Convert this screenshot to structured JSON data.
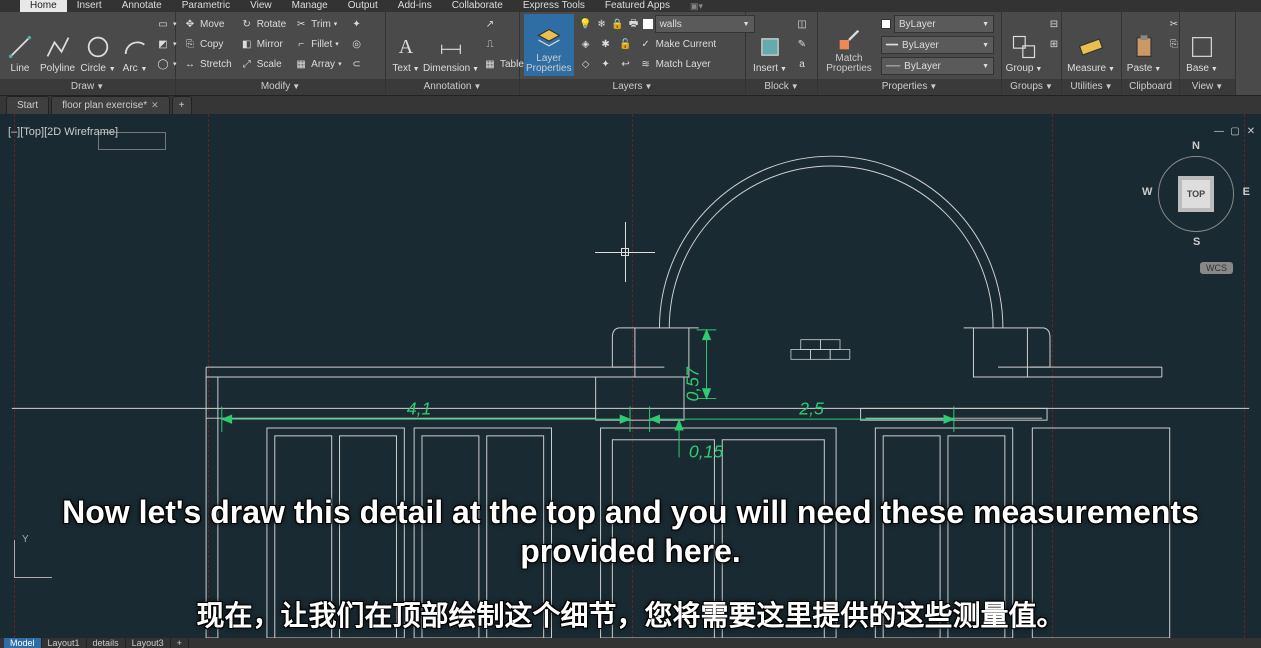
{
  "menu": {
    "tabs": [
      "Home",
      "Insert",
      "Annotate",
      "Parametric",
      "View",
      "Manage",
      "Output",
      "Add-ins",
      "Collaborate",
      "Express Tools",
      "Featured Apps"
    ],
    "active": "Home"
  },
  "ribbon": {
    "draw": {
      "title": "Draw",
      "line": "Line",
      "polyline": "Polyline",
      "circle": "Circle",
      "arc": "Arc"
    },
    "modify": {
      "title": "Modify",
      "move": "Move",
      "copy": "Copy",
      "stretch": "Stretch",
      "rotate": "Rotate",
      "mirror": "Mirror",
      "scale": "Scale",
      "trim": "Trim",
      "fillet": "Fillet",
      "array": "Array"
    },
    "annotation": {
      "title": "Annotation",
      "text": "Text",
      "dimension": "Dimension",
      "table": "Table"
    },
    "layers": {
      "title": "Layers",
      "layer_properties_l1": "Layer",
      "layer_properties_l2": "Properties",
      "current_layer": "walls",
      "make_current": "Make Current",
      "match_layer": "Match Layer"
    },
    "block": {
      "title": "Block",
      "insert": "Insert"
    },
    "properties": {
      "title": "Properties",
      "match_l1": "Match",
      "match_l2": "Properties",
      "bylayer1": "ByLayer",
      "bylayer2": "ByLayer",
      "bylayer3": "ByLayer"
    },
    "groups": {
      "title": "Groups",
      "group": "Group"
    },
    "utilities": {
      "title": "Utilities",
      "measure": "Measure"
    },
    "clipboard": {
      "title": "Clipboard",
      "paste": "Paste"
    },
    "view": {
      "title": "View",
      "base": "Base"
    }
  },
  "documents": {
    "tabs": [
      {
        "label": "Start",
        "closeable": false
      },
      {
        "label": "floor plan exercise*",
        "closeable": true
      }
    ]
  },
  "viewport": {
    "label": "[–][Top][2D Wireframe]",
    "viewcube_face": "TOP",
    "wcs": "WCS"
  },
  "ucs": {
    "y_label": "Y"
  },
  "dimensions": {
    "d1": "4,1",
    "d2": "2,5",
    "d3": "0,57",
    "d4": "0,15"
  },
  "subtitles": {
    "english": "Now let's draw this detail at the top and you will need these measurements provided here.",
    "chinese": "现在，让我们在顶部绘制这个细节，您将需要这里提供的这些测量值。"
  },
  "status": {
    "tabs": [
      "Model",
      "Layout1",
      "details",
      "Layout3"
    ],
    "active": "Model"
  },
  "colors": {
    "dimension": "#2ecc71",
    "drawing": "#d0d0d0",
    "canvas": "#1a2a32"
  }
}
